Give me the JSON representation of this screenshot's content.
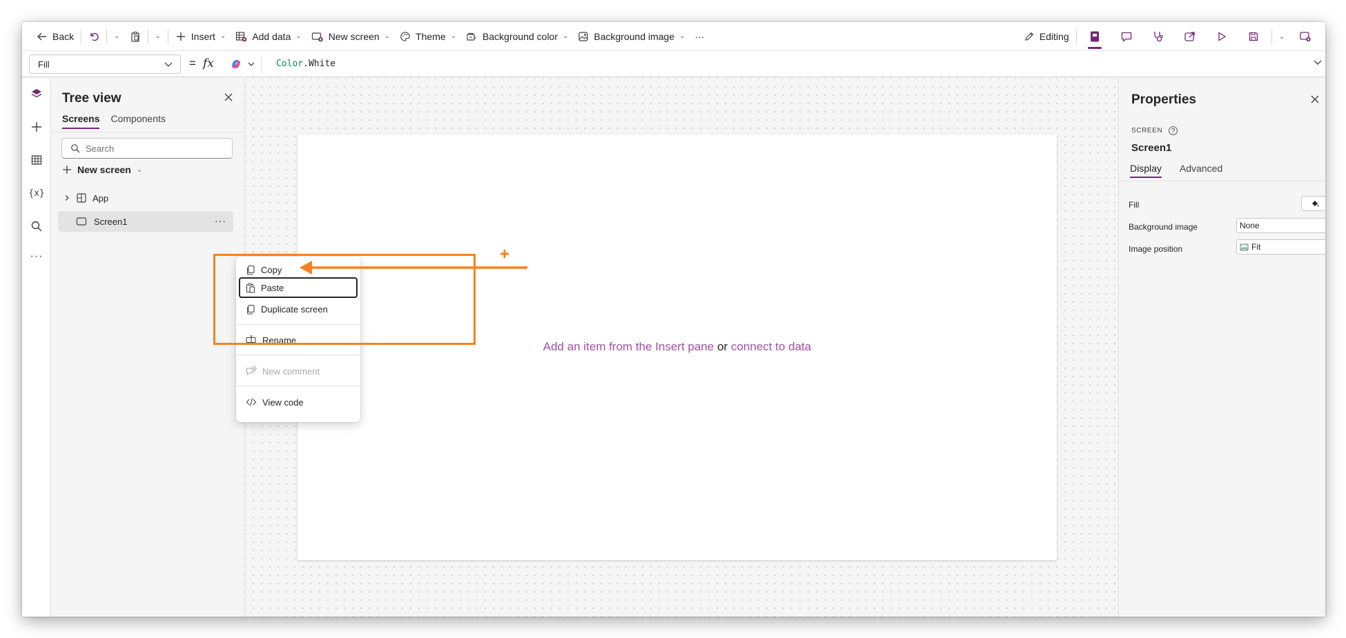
{
  "toolbar": {
    "back_label": "Back",
    "insert_label": "Insert",
    "add_data_label": "Add data",
    "new_screen_label": "New screen",
    "theme_label": "Theme",
    "background_color_label": "Background color",
    "background_image_label": "Background image",
    "more_label": "···",
    "editing_label": "Editing"
  },
  "formula_bar": {
    "property": "Fill",
    "equals": "=",
    "fx": "fx",
    "formula_keyword": "Color",
    "formula_rest": ".White"
  },
  "tree_view": {
    "title": "Tree view",
    "tabs": [
      "Screens",
      "Components"
    ],
    "active_tab": "Screens",
    "search_placeholder": "Search",
    "new_screen_label": "New screen",
    "nodes": [
      {
        "label": "App",
        "icon": "app-icon"
      },
      {
        "label": "Screen1",
        "icon": "screen-icon",
        "selected": true
      }
    ]
  },
  "context_menu": {
    "items": [
      {
        "label": "Copy",
        "icon": "copy-icon",
        "state": "normal"
      },
      {
        "label": "Paste",
        "icon": "paste-icon",
        "state": "focused"
      },
      {
        "label": "Duplicate screen",
        "icon": "duplicate-icon",
        "state": "normal"
      },
      {
        "label": "Rename",
        "icon": "rename-icon",
        "state": "normal"
      },
      {
        "label": "New comment",
        "icon": "comment-icon",
        "state": "disabled"
      },
      {
        "label": "View code",
        "icon": "code-icon",
        "state": "normal"
      }
    ]
  },
  "canvas": {
    "hint_part1": "Add an item from the Insert pane",
    "hint_or": "or",
    "hint_link": "connect to data"
  },
  "properties": {
    "title": "Properties",
    "kind": "SCREEN",
    "name": "Screen1",
    "tabs": [
      "Display",
      "Advanced"
    ],
    "active_tab": "Display",
    "fill_label": "Fill",
    "background_image_label": "Background image",
    "background_image_value": "None",
    "image_position_label": "Image position",
    "image_position_value": "Fit"
  },
  "colors": {
    "accent": "#742774",
    "annotation": "#f58220",
    "link": "#a44ea3"
  }
}
